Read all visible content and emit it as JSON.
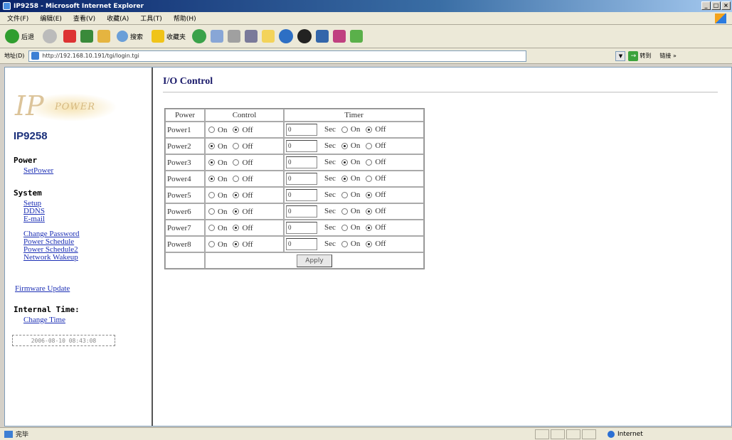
{
  "window": {
    "title": "IP9258 - Microsoft Internet Explorer",
    "controls": [
      "_",
      "□",
      "×"
    ]
  },
  "menu": [
    "文件(F)",
    "编辑(E)",
    "查看(V)",
    "收藏(A)",
    "工具(T)",
    "帮助(H)"
  ],
  "toolbar": {
    "back_label": "后退",
    "search_label": "搜索",
    "favorites_label": "收藏夹"
  },
  "addressbar": {
    "label": "地址(D)",
    "url": "http://192.168.10.191/tgi/login.tgi",
    "go_label": "转到",
    "links_label": "链接 »"
  },
  "sidebar": {
    "logo_letters": "IP",
    "logo_word": "POWER",
    "device_name": "IP9258",
    "power_heading": "Power",
    "power_links": [
      "SetPower"
    ],
    "system_heading": "System",
    "system_links": [
      "Setup",
      "DDNS",
      "E-mail",
      "Change Password",
      "Power Schedule",
      "Power Schedule2",
      "Network Wakeup"
    ],
    "firmware_link": "Firmware Update",
    "time_heading": "Internal Time:",
    "time_link": "Change Time",
    "time_value": "2006-08-10 08:43:08"
  },
  "main": {
    "title": "I/O Control",
    "table": {
      "col_power": "Power",
      "col_control": "Control",
      "col_timer": "Timer",
      "on_label": "On",
      "off_label": "Off",
      "sec_label": "Sec",
      "rows": [
        {
          "name": "Power1",
          "control": "off",
          "timer_value": "0",
          "timer": "off"
        },
        {
          "name": "Power2",
          "control": "on",
          "timer_value": "0",
          "timer": "on"
        },
        {
          "name": "Power3",
          "control": "on",
          "timer_value": "0",
          "timer": "on"
        },
        {
          "name": "Power4",
          "control": "on",
          "timer_value": "0",
          "timer": "on"
        },
        {
          "name": "Power5",
          "control": "off",
          "timer_value": "0",
          "timer": "off"
        },
        {
          "name": "Power6",
          "control": "off",
          "timer_value": "0",
          "timer": "off"
        },
        {
          "name": "Power7",
          "control": "off",
          "timer_value": "0",
          "timer": "off"
        },
        {
          "name": "Power8",
          "control": "off",
          "timer_value": "0",
          "timer": "off"
        }
      ],
      "apply_label": "Apply"
    }
  },
  "status": {
    "text": "完毕",
    "zone": "Internet"
  }
}
